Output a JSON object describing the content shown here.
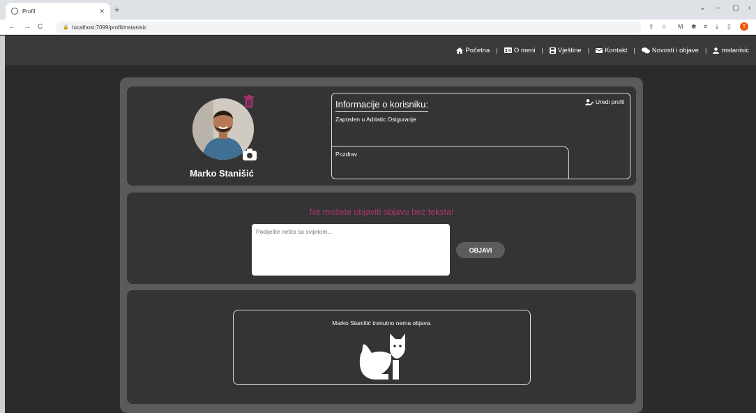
{
  "browser": {
    "tab_title": "Profil",
    "url": "localhost:7099/profil/mstanisic",
    "profile_initial": "T"
  },
  "navbar": {
    "items": [
      {
        "label": "Početna",
        "icon": "home-icon"
      },
      {
        "label": "O meni",
        "icon": "id-card-icon"
      },
      {
        "label": "Vještine",
        "icon": "save-icon"
      },
      {
        "label": "Kontakt",
        "icon": "envelope-icon"
      },
      {
        "label": "Novosti i objave",
        "icon": "comments-icon"
      },
      {
        "label": "mstanisic",
        "icon": "user-icon"
      }
    ],
    "separator": "|"
  },
  "profile": {
    "name": "Marko Stanišić",
    "info_title": "Informacije o korisniku:",
    "edit_label": "Uredi profil",
    "job": "Zaposlen u Adriatic Osiguranje",
    "greeting": "Pozdrav"
  },
  "composer": {
    "warning": "Ne možete objaviti objavu bez teksta!",
    "placeholder": "Podijelite nešto sa svijetom...",
    "button_label": "OBJAVI"
  },
  "posts": {
    "empty_message": "Marko Stanišić trenutno nema objava."
  },
  "colors": {
    "accent": "#a8336e",
    "page_bg": "#2b2b2b",
    "section_bg": "#343434"
  }
}
